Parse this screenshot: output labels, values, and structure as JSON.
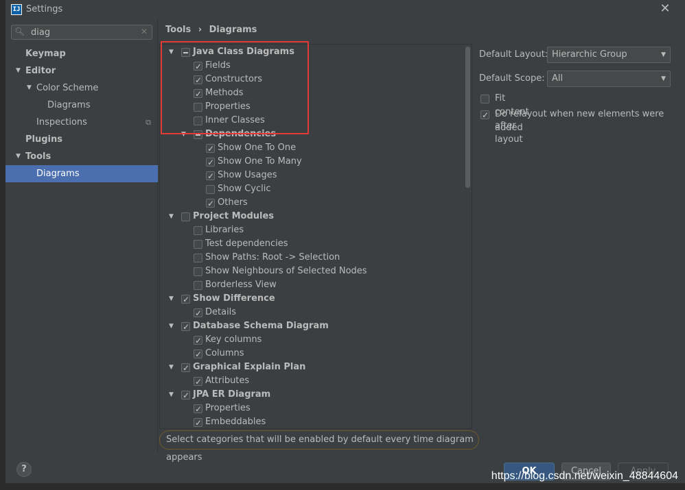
{
  "window": {
    "title": "Settings",
    "icon_text": "IJ"
  },
  "search": {
    "value": "diag"
  },
  "sidebar": {
    "items": [
      {
        "label": "Keymap"
      },
      {
        "label": "Editor"
      },
      {
        "label": "Color Scheme"
      },
      {
        "label": "Diagrams"
      },
      {
        "label": "Inspections"
      },
      {
        "label": "Plugins"
      },
      {
        "label": "Tools"
      },
      {
        "label": "Diagrams"
      }
    ]
  },
  "breadcrumb": {
    "parent": "Tools",
    "separator": "›",
    "current": "Diagrams"
  },
  "tree": [
    {
      "label": "Java Class Diagrams",
      "state": "partial",
      "group": true
    },
    {
      "label": "Fields",
      "state": "checked"
    },
    {
      "label": "Constructors",
      "state": "checked"
    },
    {
      "label": "Methods",
      "state": "checked"
    },
    {
      "label": "Properties",
      "state": "unchecked"
    },
    {
      "label": "Inner Classes",
      "state": "unchecked"
    },
    {
      "label": "Dependencies",
      "state": "partial",
      "group": true
    },
    {
      "label": "Show One To One",
      "state": "checked"
    },
    {
      "label": "Show One To Many",
      "state": "checked"
    },
    {
      "label": "Show Usages",
      "state": "checked"
    },
    {
      "label": "Show Cyclic",
      "state": "unchecked"
    },
    {
      "label": "Others",
      "state": "checked"
    },
    {
      "label": "Project Modules",
      "state": "unchecked",
      "group": true
    },
    {
      "label": "Libraries",
      "state": "unchecked"
    },
    {
      "label": "Test dependencies",
      "state": "unchecked"
    },
    {
      "label": "Show Paths: Root -> Selection",
      "state": "unchecked"
    },
    {
      "label": "Show Neighbours of Selected Nodes",
      "state": "unchecked"
    },
    {
      "label": "Borderless View",
      "state": "unchecked"
    },
    {
      "label": "Show Difference",
      "state": "checked",
      "group": true
    },
    {
      "label": "Details",
      "state": "checked"
    },
    {
      "label": "Database Schema Diagram",
      "state": "checked",
      "group": true
    },
    {
      "label": "Key columns",
      "state": "checked"
    },
    {
      "label": "Columns",
      "state": "checked"
    },
    {
      "label": "Graphical Explain Plan",
      "state": "checked",
      "group": true
    },
    {
      "label": "Attributes",
      "state": "checked"
    },
    {
      "label": "JPA ER Diagram",
      "state": "checked",
      "group": true
    },
    {
      "label": "Properties",
      "state": "checked"
    },
    {
      "label": "Embeddables",
      "state": "checked"
    }
  ],
  "hint": "Select categories that will be enabled by default every time diagram appears",
  "options": {
    "default_layout_label": "Default Layout:",
    "default_layout_value": "Hierarchic Group",
    "default_scope_label": "Default Scope:",
    "default_scope_value": "All",
    "fit_content_label": "Fit content after layout",
    "fit_content_checked": false,
    "relayout_label": "Do relayout when new elements were added",
    "relayout_checked": true
  },
  "buttons": {
    "help": "?",
    "ok": "OK",
    "cancel": "Cancel",
    "apply": "Apply"
  },
  "watermark": "https://blog.csdn.net/weixin_48844604"
}
